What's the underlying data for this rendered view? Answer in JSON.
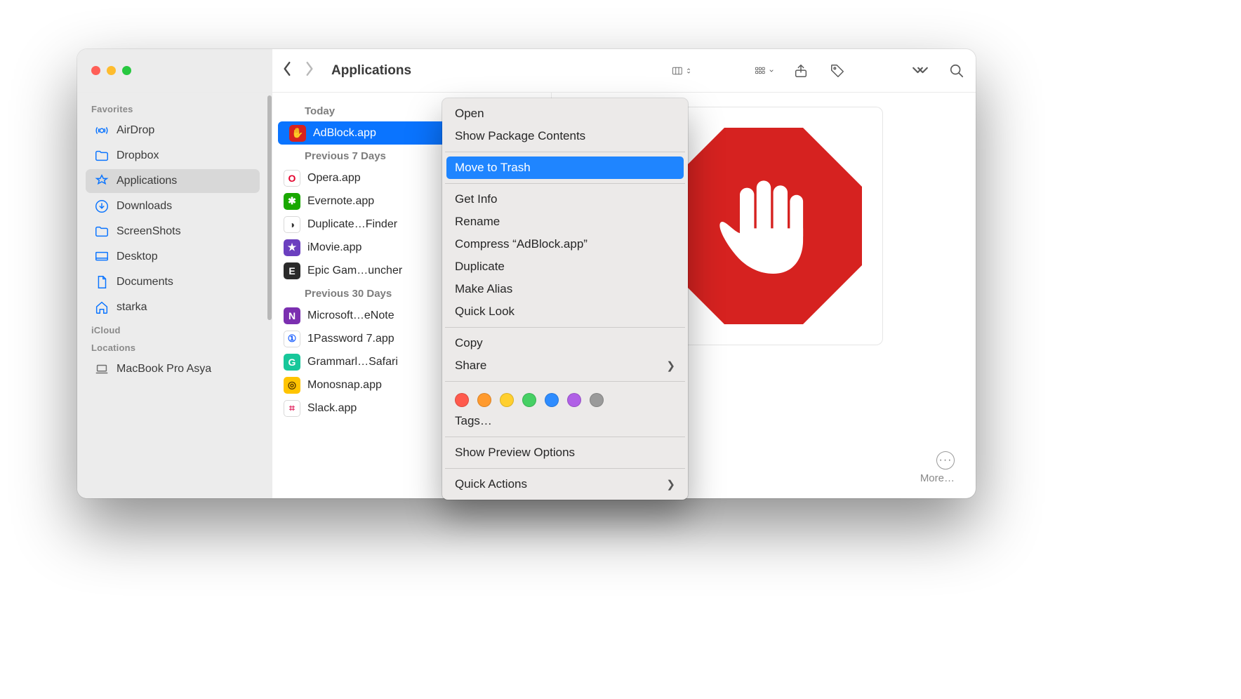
{
  "toolbar": {
    "title": "Applications"
  },
  "sidebar": {
    "groups": [
      {
        "label": "Favorites",
        "items": [
          {
            "name": "AirDrop",
            "icon": "airdrop"
          },
          {
            "name": "Dropbox",
            "icon": "folder"
          },
          {
            "name": "Applications",
            "icon": "appstore",
            "active": true
          },
          {
            "name": "Downloads",
            "icon": "download"
          },
          {
            "name": "ScreenShots",
            "icon": "folder"
          },
          {
            "name": "Desktop",
            "icon": "desktop"
          },
          {
            "name": "Documents",
            "icon": "document"
          },
          {
            "name": "starka",
            "icon": "home"
          }
        ]
      },
      {
        "label": "iCloud",
        "items": []
      },
      {
        "label": "Locations",
        "items": [
          {
            "name": "MacBook Pro Asya",
            "icon": "laptop",
            "locations": true
          }
        ]
      }
    ]
  },
  "list": {
    "groups": [
      {
        "label": "Today",
        "items": [
          {
            "name": "AdBlock.app",
            "selected": true,
            "ic": "adblock"
          }
        ]
      },
      {
        "label": "Previous 7 Days",
        "items": [
          {
            "name": "Opera.app",
            "ic": "opera"
          },
          {
            "name": "Evernote.app",
            "ic": "evernote"
          },
          {
            "name": "Duplicate…Finder",
            "ic": "dup"
          },
          {
            "name": "iMovie.app",
            "ic": "imovie"
          },
          {
            "name": "Epic Gam…uncher",
            "ic": "epic"
          }
        ]
      },
      {
        "label": "Previous 30 Days",
        "items": [
          {
            "name": "Microsoft…eNote",
            "ic": "onenote"
          },
          {
            "name": "1Password 7.app",
            "ic": "1pw"
          },
          {
            "name": "Grammarl…Safari",
            "ic": "grammarly"
          },
          {
            "name": "Monosnap.app",
            "ic": "monosnap"
          },
          {
            "name": "Slack.app",
            "ic": "slack"
          }
        ]
      }
    ]
  },
  "context_menu": {
    "items": [
      {
        "label": "Open"
      },
      {
        "label": "Show Package Contents"
      },
      {
        "sep": true
      },
      {
        "label": "Move to Trash",
        "highlight": true
      },
      {
        "sep": true
      },
      {
        "label": "Get Info"
      },
      {
        "label": "Rename"
      },
      {
        "label": "Compress “AdBlock.app”"
      },
      {
        "label": "Duplicate"
      },
      {
        "label": "Make Alias"
      },
      {
        "label": "Quick Look"
      },
      {
        "sep": true
      },
      {
        "label": "Copy"
      },
      {
        "label": "Share",
        "submenu": true
      },
      {
        "sep": true
      },
      {
        "tags": true,
        "colors": [
          "#ff5a4d",
          "#ff9a2e",
          "#ffcf2e",
          "#46d064",
          "#2e8cff",
          "#b060e6",
          "#9a9a9a"
        ]
      },
      {
        "label": "Tags…"
      },
      {
        "sep": true
      },
      {
        "label": "Show Preview Options"
      },
      {
        "sep": true
      },
      {
        "label": "Quick Actions",
        "submenu": true
      }
    ]
  },
  "preview": {
    "more_label": "More…"
  },
  "app_icon_styles": {
    "adblock": {
      "bg": "#d62220",
      "txt": "✋"
    },
    "opera": {
      "bg": "#ffffff",
      "txt": "O",
      "fg": "#e3002b",
      "border": true
    },
    "evernote": {
      "bg": "#19a800",
      "txt": "✱"
    },
    "dup": {
      "bg": "#ffffff",
      "txt": "◑",
      "fg": "#333",
      "border": true
    },
    "imovie": {
      "bg": "#6b3fbf",
      "txt": "★"
    },
    "epic": {
      "bg": "#2a2a2a",
      "txt": "E"
    },
    "onenote": {
      "bg": "#7b2fb0",
      "txt": "N"
    },
    "1pw": {
      "bg": "#ffffff",
      "txt": "①",
      "fg": "#1b5fff",
      "border": true
    },
    "grammarly": {
      "bg": "#17c79a",
      "txt": "G"
    },
    "monosnap": {
      "bg": "#ffc400",
      "txt": "◎",
      "fg": "#5a3a00"
    },
    "slack": {
      "bg": "#ffffff",
      "txt": "⌗",
      "fg": "#e01e5a",
      "border": true
    }
  }
}
